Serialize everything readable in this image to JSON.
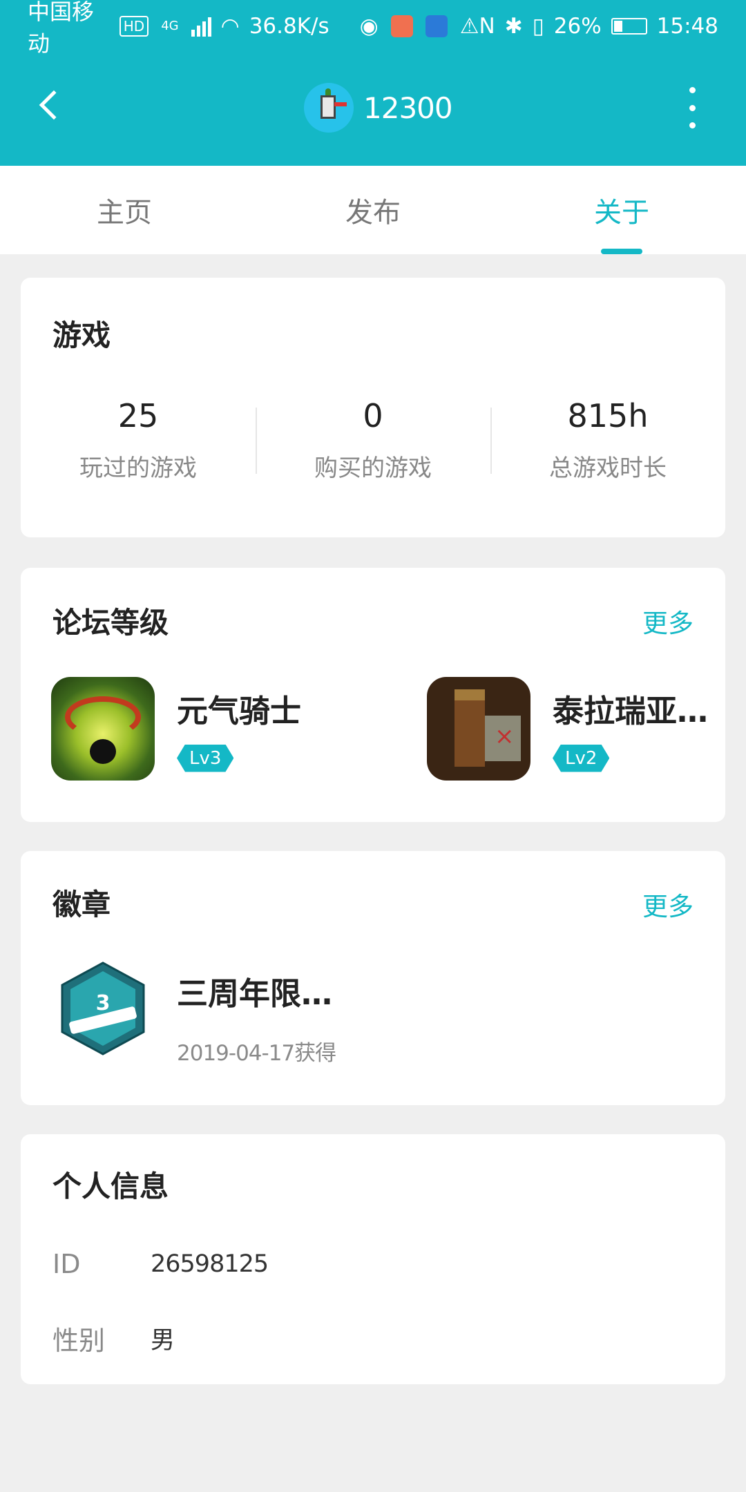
{
  "status_bar": {
    "carrier": "中国移动",
    "hd": "HD",
    "network": "4G",
    "speed": "36.8K/s",
    "battery": "26%",
    "time": "15:48",
    "notification_colors": [
      "#f07050",
      "#2b7ad8"
    ]
  },
  "toolbar": {
    "title": "12300",
    "avatar": "robot-avatar",
    "accent": "#14b8c6"
  },
  "tabs": [
    {
      "label": "主页",
      "active": false
    },
    {
      "label": "发布",
      "active": false
    },
    {
      "label": "关于",
      "active": true
    }
  ],
  "games": {
    "title": "游戏",
    "stats": [
      {
        "value": "25",
        "label": "玩过的游戏"
      },
      {
        "value": "0",
        "label": "购买的游戏"
      },
      {
        "value": "815h",
        "label": "总游戏时长"
      }
    ]
  },
  "forum": {
    "title": "论坛等级",
    "more": "更多",
    "items": [
      {
        "name": "元气骑士",
        "level": "Lv3",
        "icon": "soul-knight-icon"
      },
      {
        "name": "泰拉瑞亚…",
        "level": "Lv2",
        "icon": "terraria-icon"
      }
    ]
  },
  "badges": {
    "title": "徽章",
    "more": "更多",
    "item": {
      "name": "三周年限…",
      "date": "2019-04-17获得",
      "icon": "anniversary-badge-icon"
    }
  },
  "profile": {
    "title": "个人信息",
    "rows": [
      {
        "label": "ID",
        "value": "26598125"
      },
      {
        "label": "性别",
        "value": "男"
      }
    ]
  }
}
